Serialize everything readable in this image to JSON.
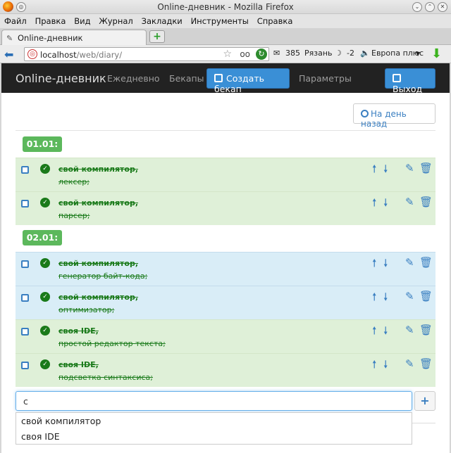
{
  "window": {
    "title": "Online-дневник - Mozilla Firefox"
  },
  "menu": [
    "Файл",
    "Правка",
    "Вид",
    "Журнал",
    "Закладки",
    "Инструменты",
    "Справка"
  ],
  "tab": {
    "label": "Online-дневник"
  },
  "url": {
    "host": "localhost",
    "path": "/web/diary/"
  },
  "status": {
    "mail": "385",
    "city": "Рязань",
    "temp": "-2",
    "radio": "Европа плюс"
  },
  "app": {
    "brand": "Online-дневник",
    "nav": {
      "daily": "Ежедневно",
      "backups": "Бекапы",
      "create_backup": "Создать бекап",
      "settings": "Параметры",
      "logout": "Выход"
    },
    "back_day": "На день назад"
  },
  "groups": [
    {
      "date": "01.01:",
      "items": [
        {
          "title": "свой компилятор,",
          "subtitle": "лексер;"
        },
        {
          "title": "свой компилятор,",
          "subtitle": "парсер;"
        }
      ]
    },
    {
      "date": "02.01:",
      "items": [
        {
          "title": "свой компилятор,",
          "subtitle": "генератор байт-кода;"
        },
        {
          "title": "свой компилятор,",
          "subtitle": "оптимизатор;"
        },
        {
          "title": "своя IDE,",
          "subtitle": "простой редактор текста;"
        },
        {
          "title": "своя IDE,",
          "subtitle": "подсветка синтаксиса;"
        }
      ]
    }
  ],
  "input": {
    "value": "с"
  },
  "suggestions": [
    "свой компилятор",
    "своя IDE"
  ],
  "colors": {
    "navbar": "#222222",
    "primary": "#3a8fd6",
    "badge": "#5cb85c",
    "row_green": "#dff0d8",
    "row_blue": "#d9edf7",
    "done_text": "#1a7a1a"
  }
}
